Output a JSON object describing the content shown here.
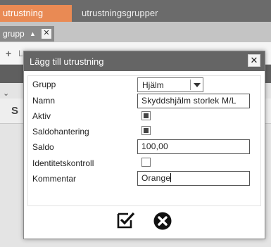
{
  "tabs": {
    "active": "utrustning",
    "groups": "utrustningsgrupper"
  },
  "subtab": {
    "label": "grupp",
    "sort_glyph": "▲",
    "close_glyph": "✕"
  },
  "background": {
    "add_glyph": "+",
    "add_label": "L",
    "chevron": "⌄",
    "row_letter": "S"
  },
  "dialog": {
    "title": "Lägg till utrustning",
    "close_glyph": "✕",
    "fields": {
      "grupp": {
        "label": "Grupp",
        "value": "Hjälm"
      },
      "namn": {
        "label": "Namn",
        "value": "Skyddshjälm storlek M/L"
      },
      "aktiv": {
        "label": "Aktiv",
        "checked": true
      },
      "saldohantering": {
        "label": "Saldohantering",
        "checked": true
      },
      "saldo": {
        "label": "Saldo",
        "value": "100,00"
      },
      "identitetskontroll": {
        "label": "Identitetskontroll",
        "checked": false
      },
      "kommentar": {
        "label": "Kommentar",
        "value": "Orange"
      }
    },
    "buttons": {
      "ok_icon": "checkbox-confirm-icon",
      "cancel_icon": "close-circle-icon"
    }
  },
  "colors": {
    "tab_active": "#e98a54",
    "titlebar": "#656565",
    "topbar": "#6b6b6b"
  }
}
